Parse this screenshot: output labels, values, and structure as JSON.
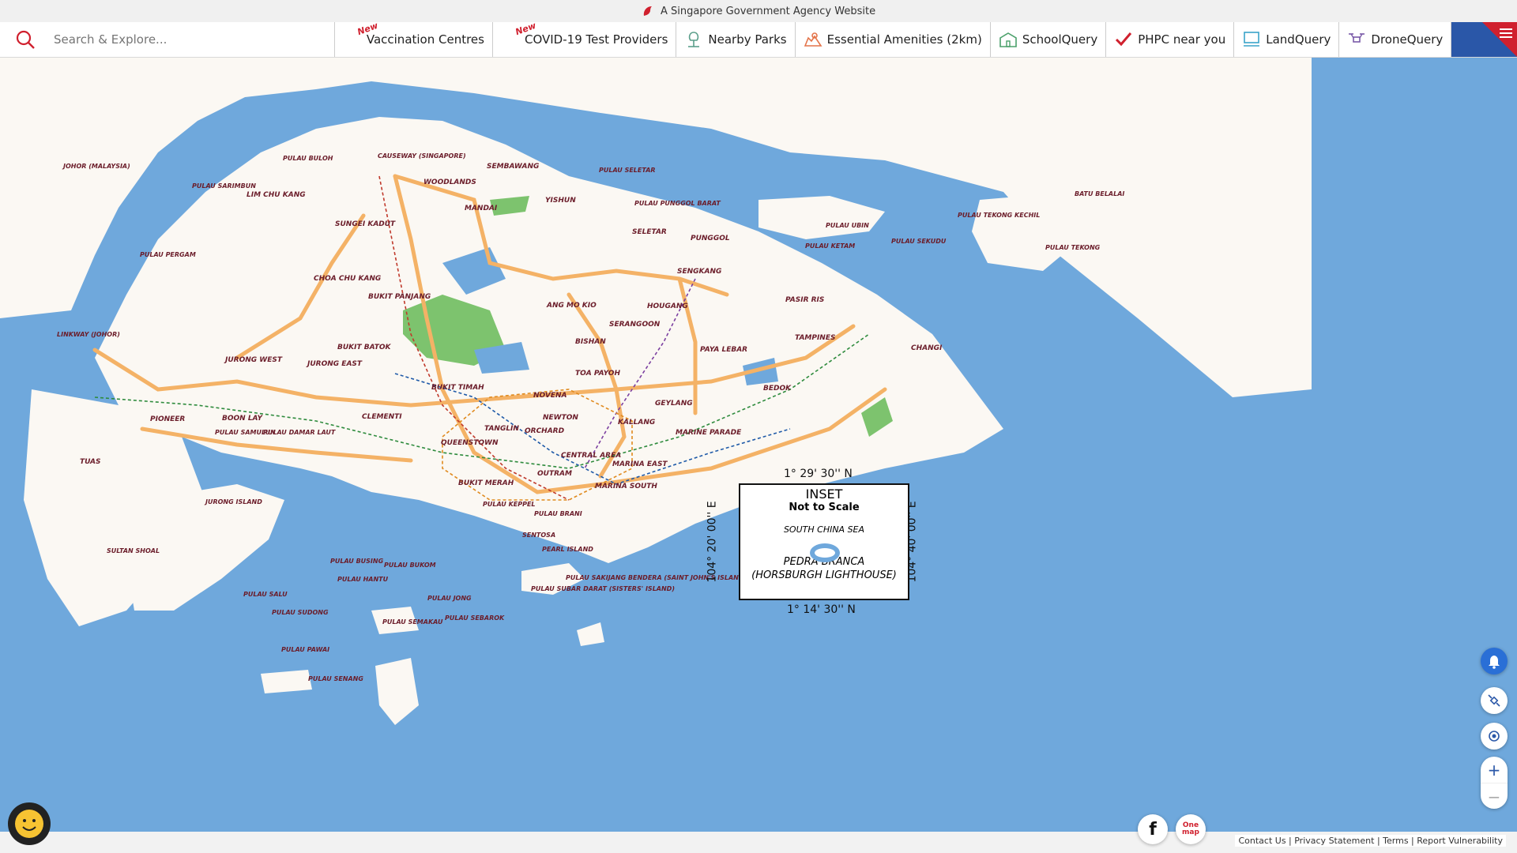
{
  "banner": {
    "text": "A Singapore Government Agency Website"
  },
  "search": {
    "placeholder": "Search & Explore..."
  },
  "tabs": [
    {
      "label": "Vaccination Centres",
      "badge": "New",
      "icon": "syringe-icon"
    },
    {
      "label": "COVID-19 Test Providers",
      "badge": "New",
      "icon": "test-icon"
    },
    {
      "label": "Nearby Parks",
      "badge": "",
      "icon": "tree-icon"
    },
    {
      "label": "Essential Amenities (2km)",
      "badge": "",
      "icon": "amenities-icon"
    },
    {
      "label": "SchoolQuery",
      "badge": "",
      "icon": "school-icon"
    },
    {
      "label": "PHPC near you",
      "badge": "",
      "icon": "phpc-icon"
    },
    {
      "label": "LandQuery",
      "badge": "",
      "icon": "land-icon"
    },
    {
      "label": "DroneQuery",
      "badge": "",
      "icon": "drone-icon"
    }
  ],
  "map": {
    "places": [
      "JOHOR (MALAYSIA)",
      "PULAU BULOH",
      "CAUSEWAY (SINGAPORE)",
      "SEMBAWANG",
      "PULAU SELETAR",
      "WOODLANDS",
      "PULAU SARIMBUN",
      "LIM CHU KANG",
      "MANDAI",
      "YISHUN",
      "PULAU PUNGGOL BARAT",
      "SUNGEI KADUT",
      "SELETAR",
      "PUNGGOL",
      "PULAU UBIN",
      "PULAU KETAM",
      "PULAU SEKUDU",
      "PULAU TEKONG KECHIL",
      "BATU BELALAI",
      "PULAU TEKONG",
      "PULAU PERGAM",
      "SENGKANG",
      "CHOA CHU KANG",
      "BUKIT PANJANG",
      "ANG MO KIO",
      "HOUGANG",
      "PASIR RIS",
      "SERANGOON",
      "LINKWAY (JOHOR)",
      "BISHAN",
      "TAMPINES",
      "PAYA LEBAR",
      "CHANGI",
      "BUKIT BATOK",
      "JURONG WEST",
      "JURONG EAST",
      "TOA PAYOH",
      "BUKIT TIMAH",
      "BEDOK",
      "NOVENA",
      "GEYLANG",
      "PIONEER",
      "BOON LAY",
      "CLEMENTI",
      "NEWTON",
      "KALLANG",
      "TANGLIN",
      "ORCHARD",
      "MARINE PARADE",
      "PULAU SAMULUN",
      "PULAU DAMAR LAUT",
      "QUEENSTOWN",
      "CENTRAL AREA",
      "TUAS",
      "MARINA EAST",
      "OUTRAM",
      "BUKIT MERAH",
      "MARINA SOUTH",
      "JURONG ISLAND",
      "PULAU KEPPEL",
      "PULAU BRANI",
      "SENTOSA",
      "PEARL ISLAND",
      "SULTAN SHOAL",
      "PULAU BUSING",
      "PULAU BUKOM",
      "PULAU HANTU",
      "PULAU SAKIJANG BENDERA (SAINT JOHN'S ISLAND)",
      "PULAU SUBAR DARAT (SISTERS' ISLAND)",
      "PULAU SALU",
      "PULAU JONG",
      "PULAU SUDONG",
      "PULAU SEBAROK",
      "PULAU SEMAKAU",
      "PULAU PAWAI",
      "PULAU SENANG"
    ],
    "inset": {
      "title": "INSET",
      "scale": "Not to Scale",
      "sea": "SOUTH CHINA SEA",
      "island": "PEDRA BRANCA",
      "lighthouse": "(HORSBURGH LIGHTHOUSE)",
      "coord_top": "1° 29' 30'' N",
      "coord_bottom": "1° 14' 30'' N",
      "coord_left": "104° 20' 00'' E",
      "coord_right": "104° 40' 00'' E"
    },
    "colors": {
      "sea": "#6fa8dc",
      "land": "#fbf8f3",
      "expressway": "#f4b266",
      "park": "#7dc36e"
    }
  },
  "controls": {
    "notifications": "bell-icon",
    "tools": "satellite-icon",
    "locate": "locate-icon",
    "zoom_in": "+",
    "zoom_out": "−"
  },
  "footer": {
    "links": "Contact Us | Privacy Statement | Terms | Report Vulnerability",
    "social": [
      "facebook-icon",
      "onemap-logo"
    ],
    "logo_text": "One map",
    "facebook_glyph": "f"
  }
}
